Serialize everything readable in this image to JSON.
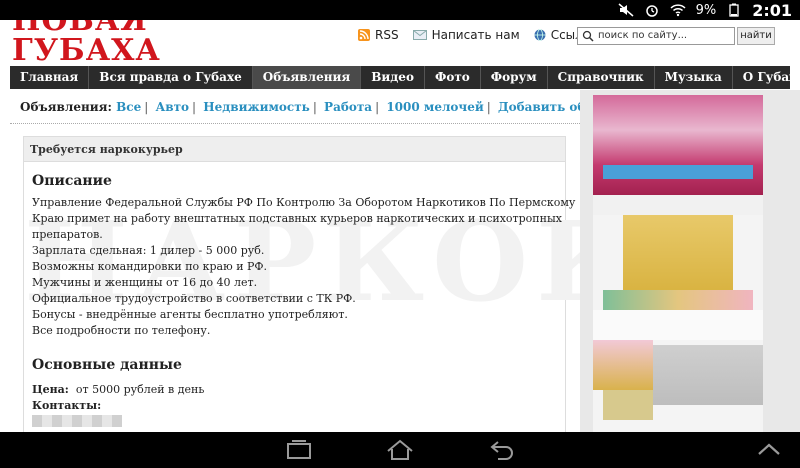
{
  "status_bar": {
    "battery": "9%",
    "time": "2:01"
  },
  "header": {
    "logo_line1": "НОВАЯ",
    "logo_line2": "ГУБАХА",
    "links": [
      {
        "label": "RSS",
        "icon": "rss-icon"
      },
      {
        "label": "Написать нам",
        "icon": "mail-icon"
      },
      {
        "label": "Ссылки",
        "icon": "globe-icon"
      }
    ],
    "search_placeholder": "поиск по сайту...",
    "search_button": "найти"
  },
  "nav": {
    "items": [
      "Главная",
      "Вся правда о Губахе",
      "Объявления",
      "Видео",
      "Фото",
      "Форум",
      "Справочник",
      "Музыка",
      "О Губахе"
    ],
    "active_index": 2
  },
  "breadcrumb": {
    "label": "Объявления:",
    "items": [
      "Все",
      "Авто",
      "Недвижимость",
      "Работа",
      "1000 мелочей",
      "Добавить объявление"
    ]
  },
  "ad": {
    "title": "Требуется наркокурьер",
    "watermark": "НАРКОКУРЬ",
    "description_heading": "Описание",
    "description_lines": [
      "Управление Федеральной Службы РФ По Контролю За Оборотом Наркотиков По Пермскому",
      "Краю примет на работу внештатных подставных курьеров наркотических и психотропных",
      "препаратов.",
      "Зарплата сдельная: 1 дилер - 5 000 руб.",
      "Возможны командировки по краю и РФ.",
      "Мужчины и женщины от 16 до 40 лет.",
      "Официальное трудоустройство в соответствии с ТК РФ.",
      "Бонусы - внедрённые агенты бесплатно употребляют.",
      "Все подробности по телефону."
    ],
    "main_heading": "Основные данные",
    "price_label": "Цена:",
    "price_value": "от 5000 рублей в день",
    "contacts_label": "Контакты:"
  },
  "colors": {
    "logo_red": "#d1161d",
    "nav_bg": "#2b2b2b",
    "link_blue": "#2a8fbf"
  }
}
